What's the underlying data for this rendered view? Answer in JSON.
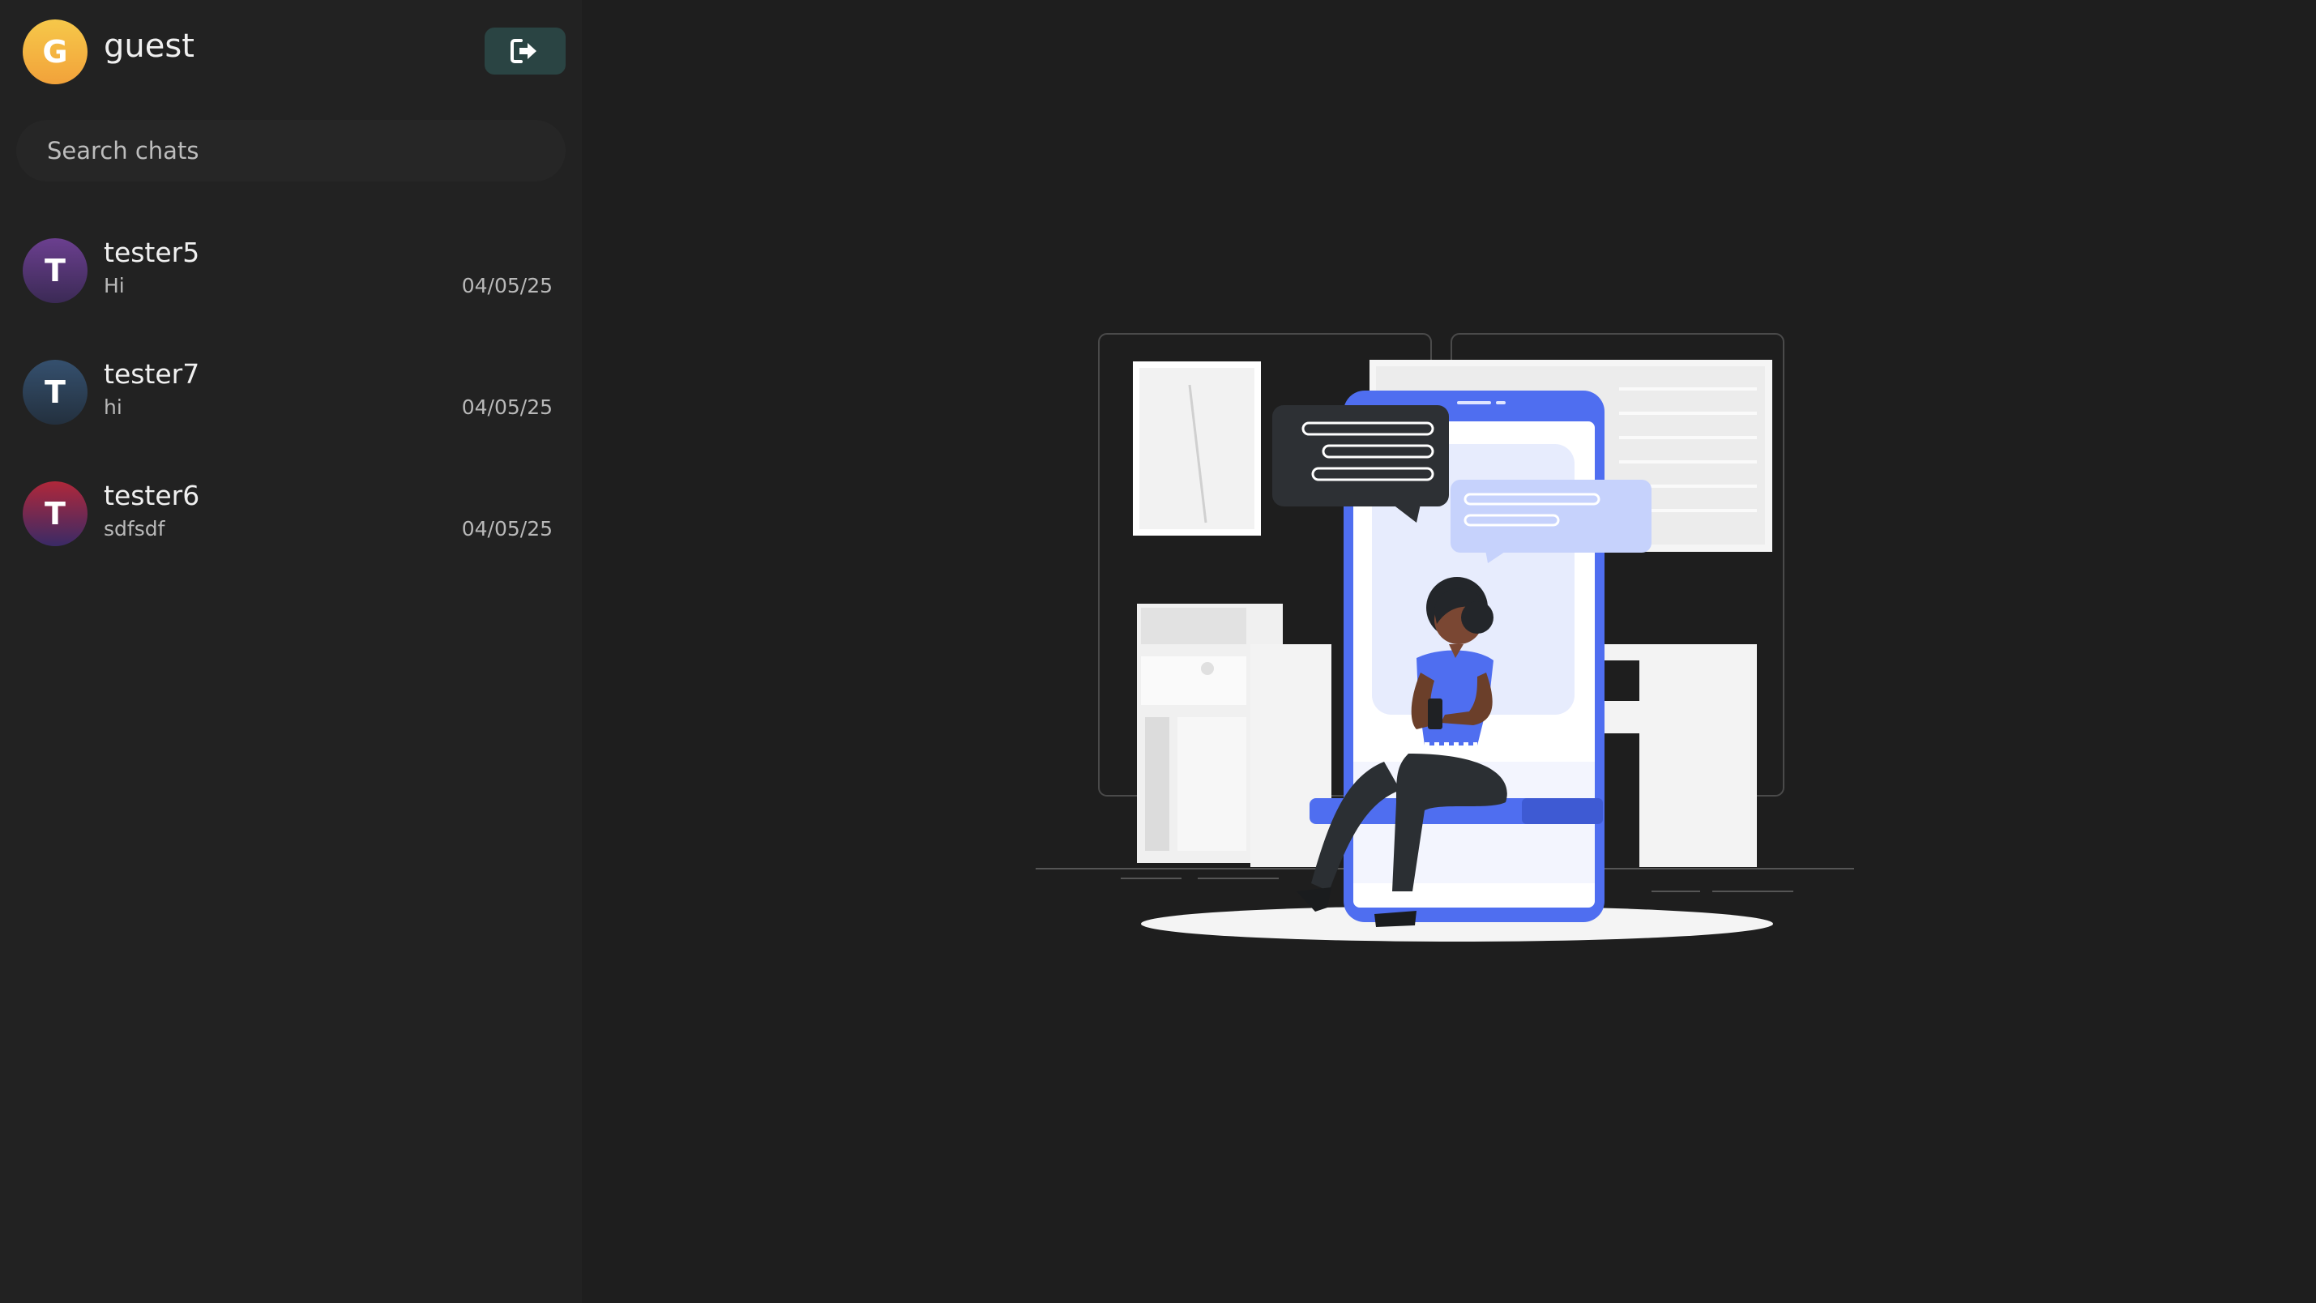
{
  "user": {
    "name": "guest",
    "initial": "G"
  },
  "search": {
    "placeholder": "Search chats"
  },
  "chats": [
    {
      "name": "tester5",
      "initial": "T",
      "last_message": "Hi",
      "date": "04/05/25",
      "avatar_gradient": [
        "#6b3f8f",
        "#3b2a55"
      ]
    },
    {
      "name": "tester7",
      "initial": "T",
      "last_message": "hi",
      "date": "04/05/25",
      "avatar_gradient": [
        "#35506e",
        "#23303e"
      ]
    },
    {
      "name": "tester6",
      "initial": "T",
      "last_message": "sdfsdf",
      "date": "04/05/25",
      "avatar_gradient": [
        "#b0283a",
        "#3a2a66"
      ]
    }
  ],
  "icons": {
    "logout": "logout-icon"
  },
  "colors": {
    "sidebar_bg": "#222222",
    "main_bg": "#1e1e1e",
    "logout_btn_bg": "#2a4443",
    "user_avatar_gradient": [
      "#f6c84a",
      "#f2a23a"
    ],
    "illustration_accent": "#4f6ef0"
  }
}
